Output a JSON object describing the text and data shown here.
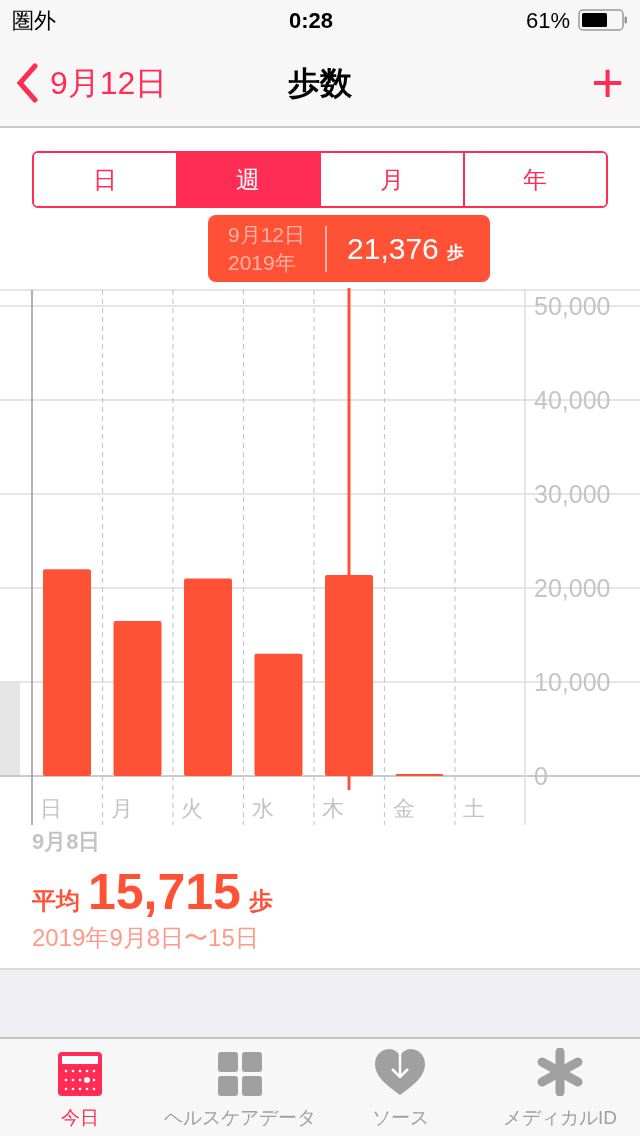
{
  "status_bar": {
    "carrier": "圏外",
    "time": "0:28",
    "battery": "61%"
  },
  "nav": {
    "back": "9月12日",
    "title": "歩数",
    "add": "+"
  },
  "segments": [
    {
      "label": "日",
      "selected": false
    },
    {
      "label": "週",
      "selected": true
    },
    {
      "label": "月",
      "selected": false
    },
    {
      "label": "年",
      "selected": false
    }
  ],
  "tooltip": {
    "date": "9月12日",
    "year": "2019年",
    "value": "21,376",
    "unit": "歩"
  },
  "chart_data": {
    "type": "bar",
    "categories": [
      "日",
      "月",
      "火",
      "水",
      "木",
      "金",
      "土"
    ],
    "series": [
      {
        "color": "#ff5136",
        "values": [
          22000,
          16500,
          21000,
          13000,
          21376,
          200,
          null
        ]
      }
    ],
    "grid": true,
    "ylim": [
      0,
      50000
    ],
    "yticks": [
      {
        "value": 0,
        "label": "0"
      },
      {
        "value": 10000,
        "label": "10,000"
      },
      {
        "value": 20000,
        "label": "20,000"
      },
      {
        "value": 30000,
        "label": "30,000"
      },
      {
        "value": 40000,
        "label": "40,000"
      },
      {
        "value": 50000,
        "label": "50,000"
      }
    ]
  },
  "week_start": "9月8日",
  "summary": {
    "label": "平均",
    "value": "15,715",
    "unit": "歩",
    "range": "2019年9月8日〜15日"
  },
  "tab_bar": [
    {
      "label": "今日",
      "selected": true
    },
    {
      "label": "ヘルスケアデータ",
      "selected": false
    },
    {
      "label": "ソース",
      "selected": false
    },
    {
      "label": "メディカルID",
      "selected": false
    }
  ]
}
